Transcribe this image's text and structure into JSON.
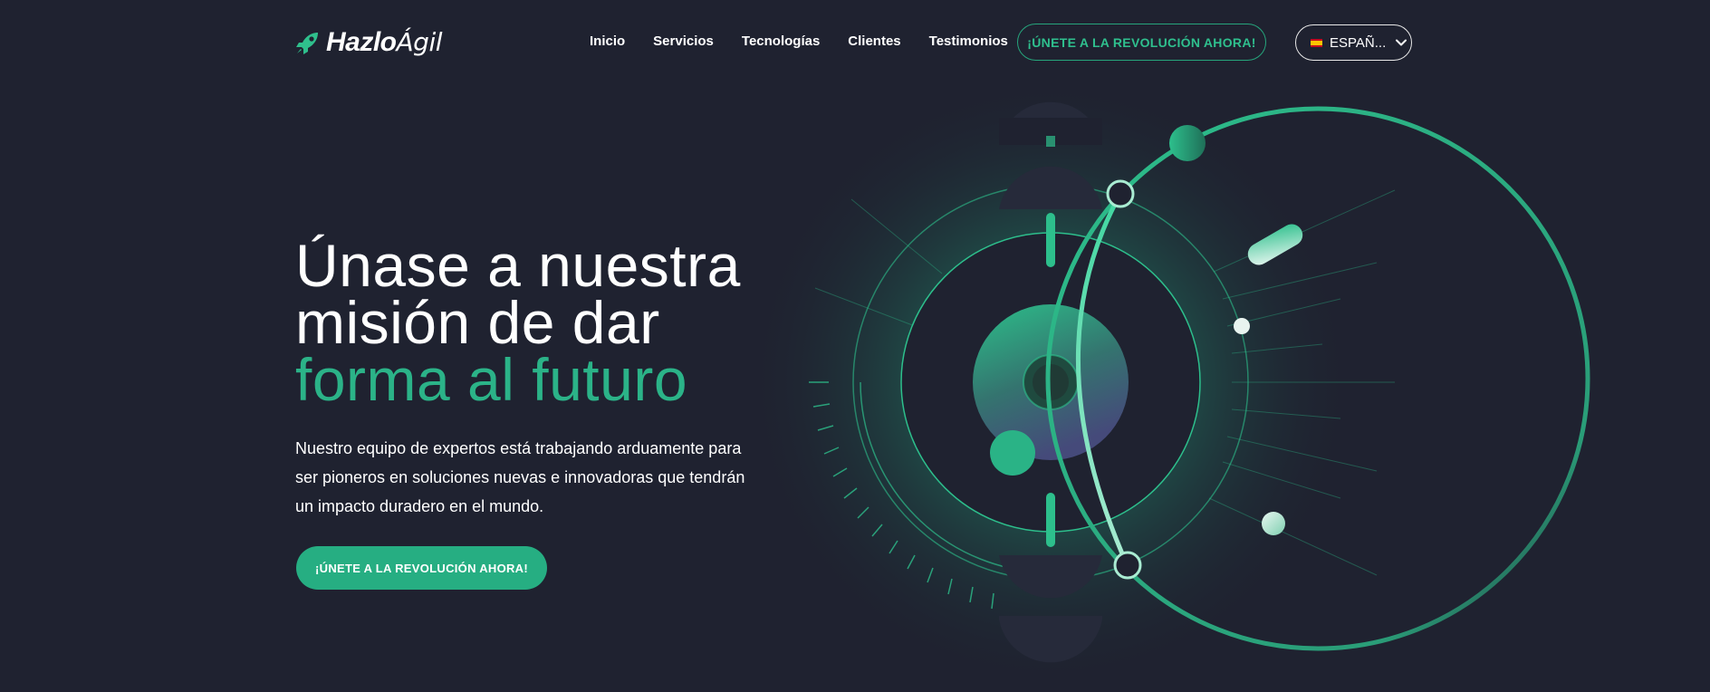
{
  "header": {
    "logo": {
      "bold": "Hazlo",
      "light": "Ágil"
    },
    "nav": [
      {
        "label": "Inicio"
      },
      {
        "label": "Servicios"
      },
      {
        "label": "Tecnologías"
      },
      {
        "label": "Clientes"
      },
      {
        "label": "Testimonios"
      }
    ],
    "cta_label": "¡ÚNETE A LA REVOLUCIÓN AHORA!",
    "language": {
      "label": "ESPAÑ...",
      "flag_icon": "spain-flag-icon",
      "chevron_icon": "chevron-down-icon"
    }
  },
  "hero": {
    "title_line1": "Únase a nuestra",
    "title_line2": "misión de dar",
    "title_accent": "forma al futuro",
    "description": "Nuestro equipo de expertos está trabajando arduamente para ser pioneros en soluciones nuevas e innovadoras que tendrán un impacto duradero en el mundo.",
    "cta_label": "¡ÚNETE A LA REVOLUCIÓN AHORA!"
  },
  "colors": {
    "background": "#1f2230",
    "accent": "#2bb388",
    "accent_dark": "#26ae82",
    "text": "#ffffff"
  }
}
